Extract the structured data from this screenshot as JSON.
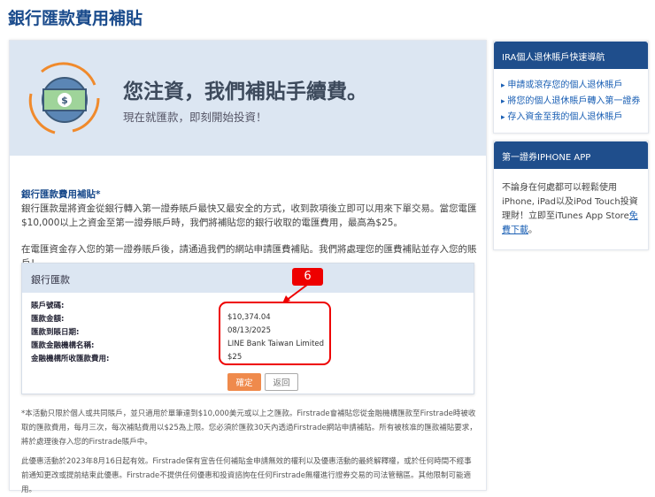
{
  "page_title": "銀行匯款費用補貼",
  "banner": {
    "headline": "您注資，我們補貼手續費。",
    "subtext": "現在就匯款，即刻開始投資！"
  },
  "intro": {
    "heading": "銀行匯款費用補貼*",
    "p1": "銀行匯款是將資金從銀行轉入第一證券賬戶最快又最安全的方式，收到款項後立即可以用來下單交易。當您電匯$10,000以上之資金至第一證券賬戶時，我們將補貼您的銀行收取的電匯費用，最高為$25。",
    "p2": "在電匯資金存入您的第一證券賬戶後，請通過我們的網站申請匯費補貼。我們將處理您的匯費補貼並存入您的賬戶！"
  },
  "form": {
    "title": "銀行匯款",
    "rows": [
      {
        "label": "賬戶號碼:",
        "value": ""
      },
      {
        "label": "匯款金額:",
        "value": "$10,374.04"
      },
      {
        "label": "匯款到賬日期:",
        "value": "08/13/2025"
      },
      {
        "label": "匯款金融機構名稱:",
        "value": "LINE Bank Taiwan Limited"
      },
      {
        "label": "金融機構所收匯款費用:",
        "value": "$25"
      }
    ],
    "confirm_label": "確定",
    "back_label": "返回",
    "annotation": "6"
  },
  "footnotes": {
    "f1": "*本活動只限於個人或共同賬戶，並只適用於單筆達到$10,000美元或以上之匯款。Firstrade會補貼您從金融機構匯款至Firstrade時被收取的匯款費用，每月三次，每次補貼費用以$25為上限。您必須於匯款30天內透過Firstrade網站申請補貼。所有被核准的匯款補貼要求，將於處理後存入您的Firstrade賬戶中。",
    "f2": "此優惠活動於2023年8月16日起有效。Firstrade保有宣告任何補貼金申請無效的權利以及優惠活動的最終解釋權，或於任何時間不經事前通知更改或提前結束此優惠。Firstrade不提供任何優惠和投資諮詢在任何Firstrade無權進行證券交易的司法管轄區。其他限制可能適用。"
  },
  "sidebar": {
    "ira_title": "IRA個人退休賬戶快速導航",
    "ira_links": [
      "申請或滾存您的個人退休賬戶",
      "將您的個人退休賬戶轉入第一證券",
      "存入資金至我的個人退休賬戶"
    ],
    "app_title": "第一證券IPHONE APP",
    "app_text": "不論身在何處都可以輕鬆使用iPhone, iPad以及iPod Touch投資理財！立即至iTunes App Store",
    "app_link": "免費下載",
    "app_end": "。"
  },
  "colors": {
    "brand": "#1f4e8c",
    "accent": "#ef8a4c",
    "annotation": "#e00000"
  }
}
